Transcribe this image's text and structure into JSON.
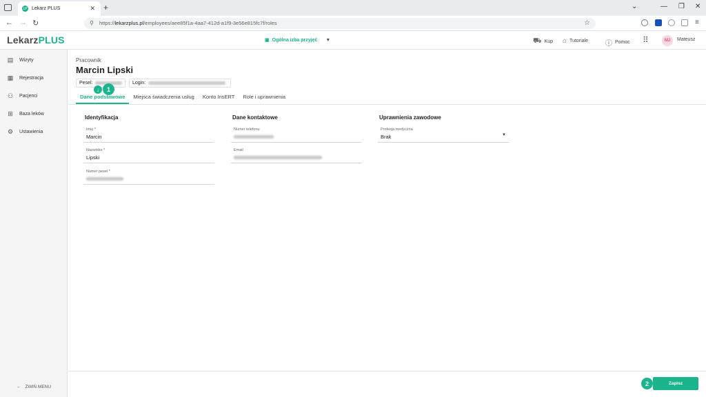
{
  "browser": {
    "tab_title": "Lekarz PLUS",
    "favicon_text": "LP",
    "url_prefix": "https://",
    "url_domain": "lekarzplus.pl",
    "url_path": "/employees/aee85f1a-4aa7-412d-a1f9-3e56e815fc7f/roles"
  },
  "app": {
    "logo_main": "Lekarz",
    "logo_accent": "PLUS",
    "department": "Ogólna izba przyjęć",
    "header_items": {
      "buy": "Kup",
      "tutorials": "Tutoriale",
      "help": "Pomoc",
      "user": "Mateusz",
      "user_initials": "MJ"
    },
    "accent_color": "#1bb48c"
  },
  "sidebar": {
    "items": [
      {
        "label": "Wizyty",
        "icon": "visits-icon"
      },
      {
        "label": "Rejestracja",
        "icon": "calendar-icon"
      },
      {
        "label": "Pacjenci",
        "icon": "patients-icon"
      },
      {
        "label": "Baza leków",
        "icon": "medicine-icon"
      },
      {
        "label": "Ustawienia",
        "icon": "gear-icon"
      }
    ],
    "collapse_label": "ZWIŃ MENU"
  },
  "employee": {
    "role_label": "Pracownik",
    "name": "Marcin Lipski",
    "pesel_label": "Pesel:",
    "login_label": "Login:"
  },
  "tabs": [
    "Dane podstawowe",
    "Miejsca świadczenia usług",
    "Konto InsERT",
    "Role i uprawnienia"
  ],
  "sections": {
    "identification": {
      "title": "Identyfikacja",
      "first_name_label": "Imię *",
      "first_name_value": "Marcin",
      "last_name_label": "Nazwisko *",
      "last_name_value": "Lipski",
      "pesel_label": "Numer pesel *"
    },
    "contact": {
      "title": "Dane kontaktowe",
      "phone_label": "Numer telefonu",
      "email_label": "Email"
    },
    "professional": {
      "title": "Uprawnienia zawodowe",
      "profession_label": "Profesja medyczna",
      "profession_value": "Brak"
    }
  },
  "annotations": {
    "step1": "1",
    "step2": "2"
  },
  "footer": {
    "save_label": "Zapisz"
  }
}
